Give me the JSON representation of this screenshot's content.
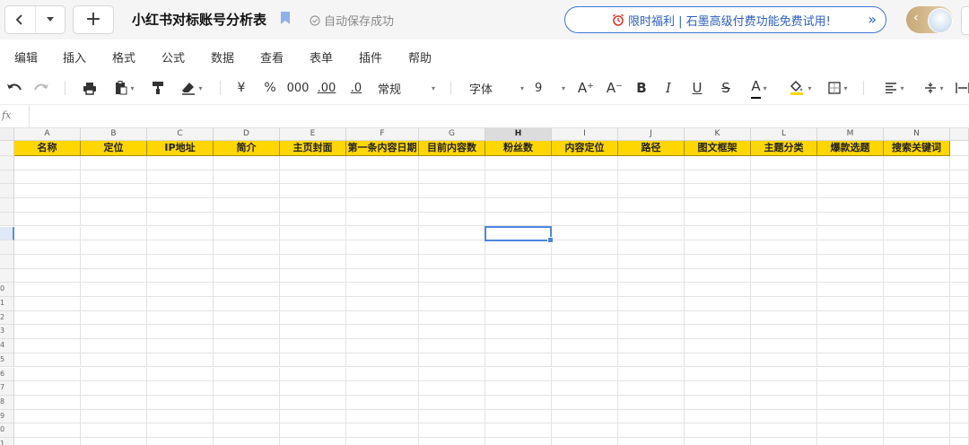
{
  "titlebar": {
    "doc_title": "小红书对标账号分析表",
    "save_status": "自动保存成功",
    "promo_text": "限时福利 | 石墨高级付费功能免费试用!",
    "promo_arrow": "»"
  },
  "menu": [
    "编辑",
    "插入",
    "格式",
    "公式",
    "数据",
    "查看",
    "表单",
    "插件",
    "帮助"
  ],
  "toolbar": {
    "currency": "¥",
    "percent": "%",
    "thousands": "000",
    "decimal_increase": ".00",
    "decimal_decrease": ".0",
    "number_format": "常规",
    "font_family": "字体",
    "font_size": "9",
    "font_grow": "A⁺",
    "font_shrink": "A⁻",
    "bold": "B",
    "italic": "I",
    "underline": "U",
    "strikethrough": "S",
    "font_color": "A",
    "colors": {
      "font_color_bar": "#000000",
      "fill_color_bar": "#ffd700"
    }
  },
  "formula_bar": {
    "fx_label": "fx",
    "value": ""
  },
  "grid": {
    "columns": [
      "A",
      "B",
      "C",
      "D",
      "E",
      "F",
      "G",
      "H",
      "I",
      "J",
      "K",
      "L",
      "M",
      "N"
    ],
    "selected_column": "H",
    "header_row": [
      "名称",
      "定位",
      "IP地址",
      "简介",
      "主页封面",
      "第一条内容日期",
      "目前内容数",
      "粉丝数",
      "内容定位",
      "路径",
      "图文框架",
      "主题分类",
      "爆款选题",
      "搜索关键词"
    ],
    "row_numbers": [
      "",
      "",
      "",
      "",
      "",
      "",
      "",
      "",
      "",
      "0",
      "1",
      "2",
      "3",
      "4",
      "5",
      "6",
      "7",
      "8",
      "9",
      "0",
      "1",
      "2"
    ],
    "header_fill": "#ffd700",
    "selection_color": "#4d86de"
  }
}
